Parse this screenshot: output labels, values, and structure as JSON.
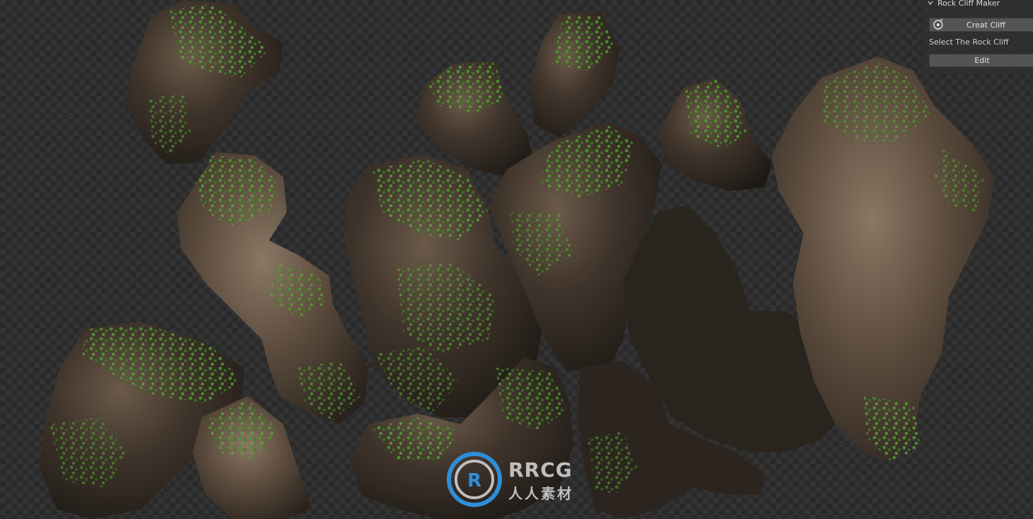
{
  "viewport": {
    "background": "transparent-checker",
    "content": "rock-cliff-render"
  },
  "panel": {
    "title": "Rock Cliff Maker",
    "create_button": "Creat Cliff",
    "select_label": "Select The Rock Cliff",
    "edit_button": "Edit"
  },
  "watermark": {
    "logo_text": "RRCG",
    "sub_text": "人人素材"
  },
  "colors": {
    "panel_bg": "#303030",
    "button_bg": "#545454",
    "rock": "#3b3229",
    "moss": "#3f8a2a"
  }
}
